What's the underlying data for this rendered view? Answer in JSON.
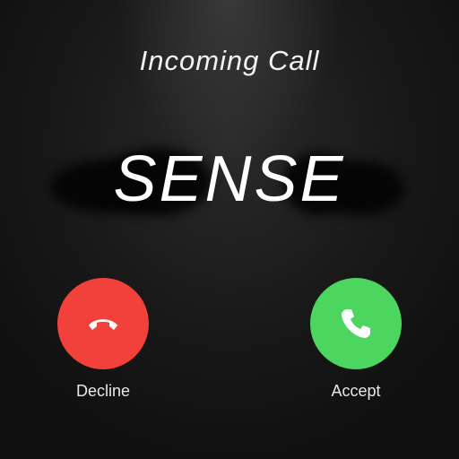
{
  "header": {
    "title": "Incoming Call"
  },
  "caller": {
    "name": "SENSE"
  },
  "actions": {
    "decline_label": "Decline",
    "accept_label": "Accept"
  },
  "colors": {
    "decline": "#f2413a",
    "accept": "#4cd660",
    "background": "#141414"
  },
  "icons": {
    "decline": "phone-hangup-icon",
    "accept": "phone-icon"
  }
}
